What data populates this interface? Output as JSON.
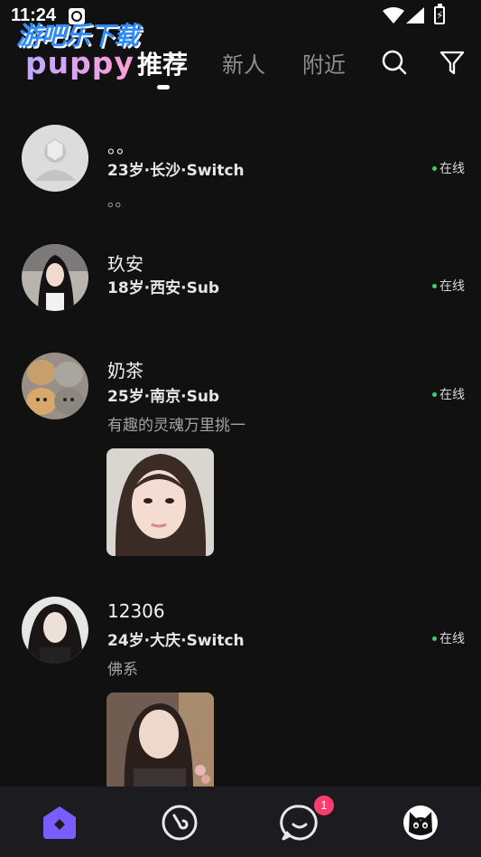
{
  "status_bar": {
    "time": "11:24"
  },
  "watermark": {
    "text": "游吧乐下载"
  },
  "header": {
    "logo": "puppy",
    "tabs": [
      {
        "label": "推荐",
        "active": true
      },
      {
        "label": "新人",
        "active": false
      },
      {
        "label": "附近",
        "active": false
      }
    ],
    "icons": [
      "search-icon",
      "filter-icon"
    ]
  },
  "feed": [
    {
      "name": "。。",
      "meta": "23岁·长沙·Switch",
      "status": "在线",
      "bio": "。。",
      "avatar": "default-avatar",
      "has_photo": false
    },
    {
      "name": "玖安",
      "meta": "18岁·西安·Sub",
      "status": "在线",
      "bio": "",
      "avatar": "user-photo-avatar",
      "has_photo": false
    },
    {
      "name": "奶茶",
      "meta": "25岁·南京·Sub",
      "status": "在线",
      "bio": "有趣的灵魂万里挑一",
      "avatar": "cats-avatar",
      "has_photo": true
    },
    {
      "name": "12306",
      "meta": "24岁·大庆·Switch",
      "status": "在线",
      "bio": "佛系",
      "avatar": "user-photo-avatar",
      "has_photo": true
    }
  ],
  "bottom_nav": {
    "items": [
      "home-icon",
      "moments-icon",
      "messages-icon",
      "profile-cat-icon"
    ],
    "message_badge": "1"
  },
  "colors": {
    "background": "#111112",
    "online": "#3dd177",
    "accent": "#7b5cff",
    "badge": "#ff3c6e"
  }
}
